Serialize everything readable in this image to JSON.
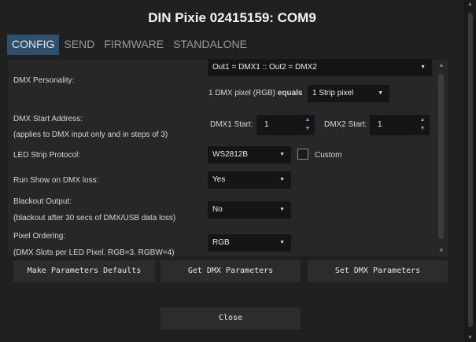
{
  "window": {
    "title": "DIN Pixie 02415159: COM9"
  },
  "tabs": [
    "CONFIG",
    "SEND",
    "FIRMWARE",
    "STANDALONE"
  ],
  "config": {
    "dmx_personality": {
      "label": "DMX Personality:",
      "value": "Out1 = DMX1 :: Out2 = DMX2",
      "equals_prefix": "1 DMX pixel (RGB)",
      "equals_word": "equals",
      "equals_value": "1 Strip pixel"
    },
    "dmx_start": {
      "label": "DMX Start Address:",
      "sublabel": "(applies to DMX input only and in steps of 3)",
      "dmx1_label": "DMX1 Start:",
      "dmx1_value": "1",
      "dmx2_label": "DMX2 Start:",
      "dmx2_value": "1"
    },
    "led_protocol": {
      "label": "LED Strip Protocol:",
      "value": "WS2812B",
      "custom_label": "Custom"
    },
    "run_show": {
      "label": "Run Show on DMX loss:",
      "value": "Yes"
    },
    "blackout": {
      "label": "Blackout Output:",
      "sublabel": "(blackout after 30 secs of DMX/USB data loss)",
      "value": "No"
    },
    "pixel_order": {
      "label": "Pixel Ordering:",
      "sublabel": "(DMX Slots per LED Pixel. RGB=3. RGBW=4)",
      "value": "RGB"
    }
  },
  "buttons": {
    "defaults": "Make Parameters Defaults",
    "get": "Get DMX Parameters",
    "set": "Set DMX Parameters",
    "close": "Close"
  },
  "icons": {
    "dropdown": "chevron-down-icon",
    "spin": "spin-arrows-icon",
    "scroll": "scroll-arrow-icon"
  },
  "colors": {
    "active_tab": "#2f4f6b",
    "spin_arrow": "#6fa8d8",
    "background": "#202020"
  }
}
